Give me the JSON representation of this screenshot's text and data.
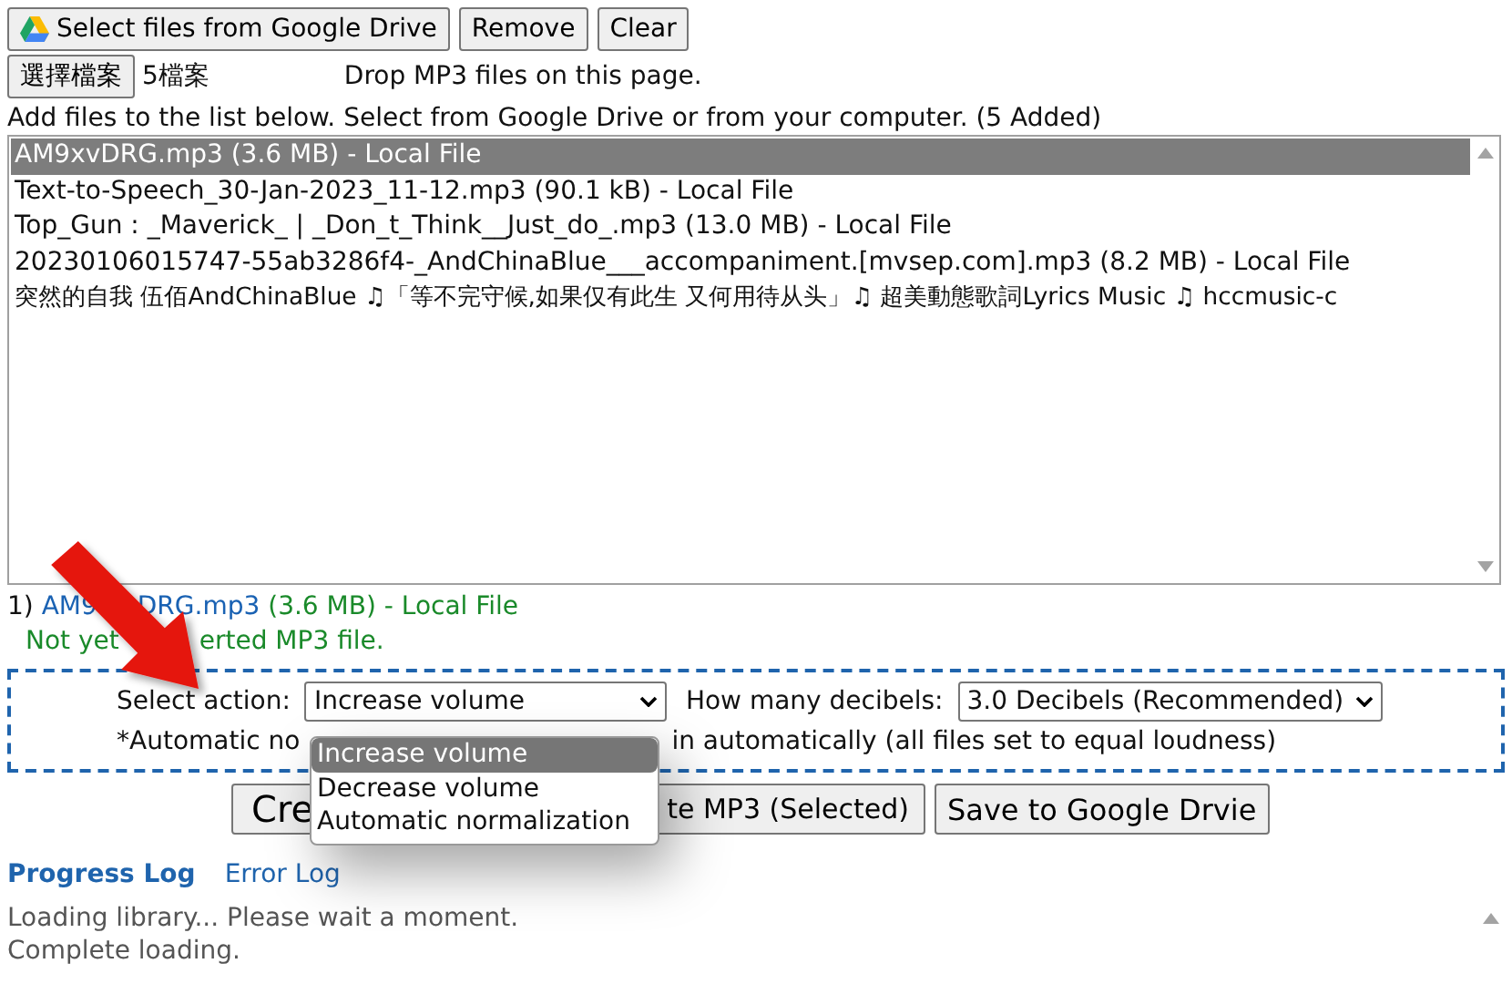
{
  "toolbar": [
    {
      "kind": "drive",
      "label": "Select files from Google Drive"
    },
    {
      "kind": "plain",
      "label": "Remove"
    },
    {
      "kind": "plain",
      "label": "Clear"
    }
  ],
  "file_input": {
    "button": "選擇檔案",
    "status": "5檔案"
  },
  "drop_hint": "Drop MP3 files on this page.",
  "instructions": "Add files to the list below. Select from Google Drive or from your computer. (5 Added)",
  "file_list": [
    {
      "label": "AM9xvDRG.mp3 (3.6 MB) - Local File",
      "selected": true
    },
    {
      "label": "Text-to-Speech_30-Jan-2023_11-12.mp3 (90.1 kB) - Local File",
      "selected": false
    },
    {
      "label": "Top_Gun : _Maverick_ | _Don_t_Think__Just_do_.mp3 (13.0 MB) - Local File",
      "selected": false
    },
    {
      "label": "20230106015747-55ab3286f4-_AndChinaBlue___accompaniment.[mvsep.com].mp3 (8.2 MB) - Local File",
      "selected": false
    },
    {
      "label": "突然的自我 伍佰AndChinaBlue ♫「等不完守候,如果仅有此生 又何用待从头」♫ 超美動態歌詞Lyrics Music ♫ hccmusic-c",
      "selected": false
    }
  ],
  "current_file": {
    "index": "1)",
    "name_start": "AM9",
    "name_end": "DRG.mp3",
    "details": "(3.6 MB) - Local File",
    "status_start": "Not yet",
    "status_end": "erted MP3 file."
  },
  "action_panel": {
    "action_label": "Select action:",
    "action_value": "Increase volume",
    "decibels_label": "How many decibels:",
    "decibels_value": "3.0 Decibels (Recommended)",
    "note_start": "*Automatic no",
    "note_end": "in automatically (all files set to equal loudness)"
  },
  "dropdown": [
    {
      "label": "Increase volume",
      "selected": true
    },
    {
      "label": "Decrease volume",
      "selected": false
    },
    {
      "label": "Automatic normalization",
      "selected": false
    }
  ],
  "action_buttons": [
    "Cre",
    "te MP3 (Selected)",
    "Save to Google Drvie"
  ],
  "log_tabs": [
    {
      "label": "Progress Log",
      "selected": true
    },
    {
      "label": "Error Log",
      "selected": false
    }
  ],
  "log_lines": [
    "Loading library... Please wait a moment.",
    "Complete loading."
  ]
}
